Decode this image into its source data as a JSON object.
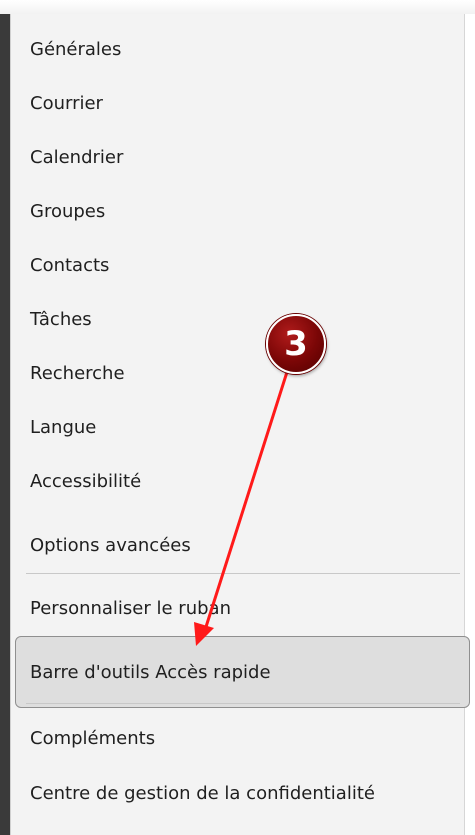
{
  "menu": {
    "items": [
      {
        "label": "Générales"
      },
      {
        "label": "Courrier"
      },
      {
        "label": "Calendrier"
      },
      {
        "label": "Groupes"
      },
      {
        "label": "Contacts"
      },
      {
        "label": "Tâches"
      },
      {
        "label": "Recherche"
      },
      {
        "label": "Langue"
      },
      {
        "label": "Accessibilité"
      },
      {
        "label": "Options avancées"
      },
      {
        "label": "Personnaliser le ruban"
      },
      {
        "label": "Barre d'outils Accès rapide"
      },
      {
        "label": "Compléments"
      },
      {
        "label": "Centre de gestion de la confidentialité"
      }
    ],
    "selected_item": "Barre d'outils Accès rapide"
  },
  "annotation": {
    "step_number": "3",
    "badge_color": "#7a0606",
    "arrow_color": "#ff1a1a"
  }
}
